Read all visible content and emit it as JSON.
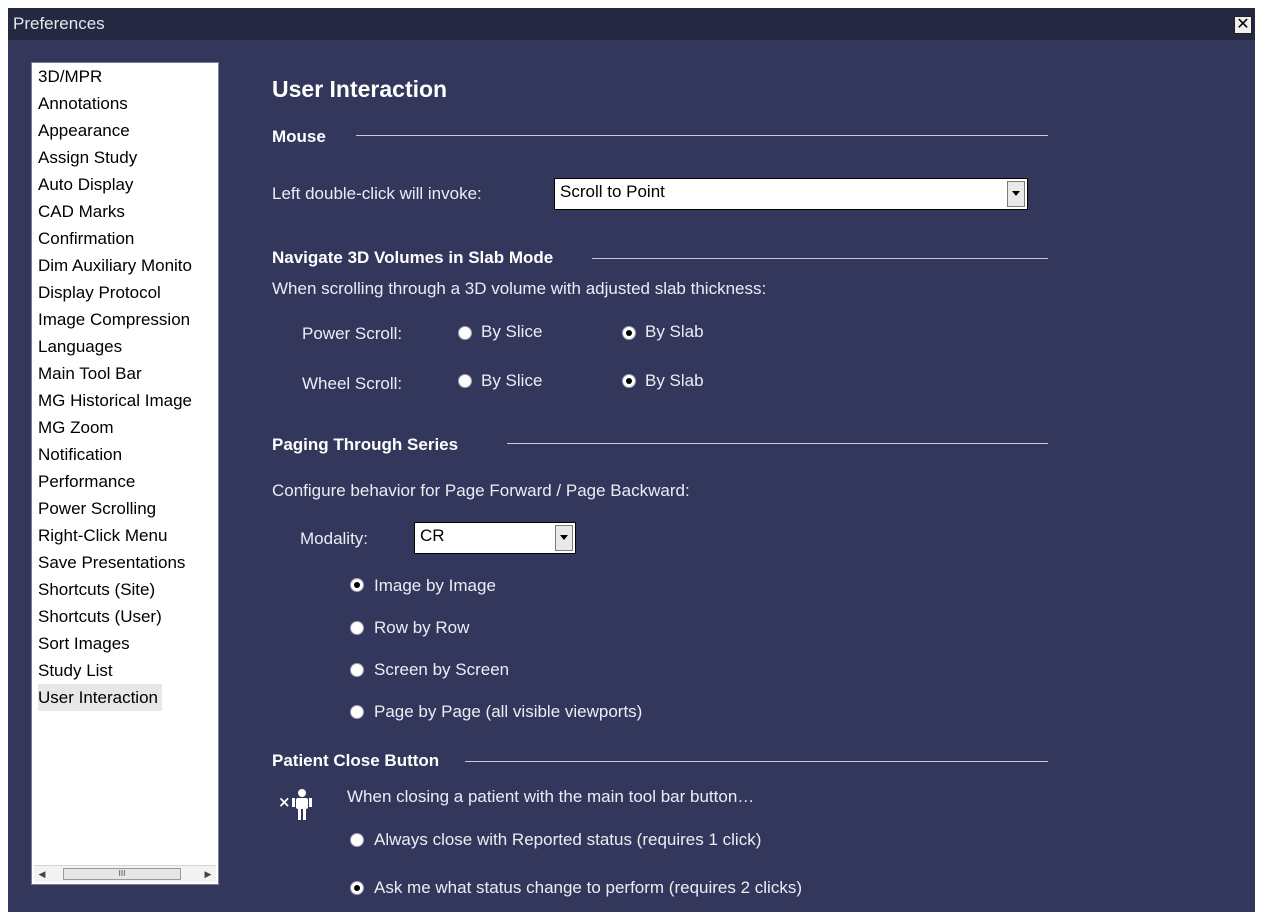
{
  "window": {
    "title": "Preferences",
    "close_label": "✕"
  },
  "sidebar": {
    "items": [
      "3D/MPR",
      "Annotations",
      "Appearance",
      "Assign Study",
      "Auto Display",
      "CAD Marks",
      "Confirmation",
      "Dim Auxiliary Monito",
      "Display Protocol",
      "Image Compression",
      "Languages",
      "Main Tool Bar",
      "MG Historical Image",
      "MG Zoom",
      "Notification",
      "Performance",
      "Power Scrolling",
      "Right-Click Menu",
      "Save Presentations",
      "Shortcuts (Site)",
      "Shortcuts (User)",
      "Sort Images",
      "Study List",
      "User Interaction"
    ],
    "selected": "User Interaction",
    "scroll_grip": "III"
  },
  "main": {
    "title": "User Interaction",
    "mouse": {
      "heading": "Mouse",
      "dblclick_label": "Left double-click will invoke:",
      "dblclick_value": "Scroll to Point"
    },
    "slab": {
      "heading": "Navigate 3D Volumes in Slab Mode",
      "description": "When scrolling through a 3D volume with adjusted slab thickness:",
      "power_label": "Power Scroll:",
      "wheel_label": "Wheel Scroll:",
      "by_slice": "By Slice",
      "by_slab": "By Slab",
      "power_selected": "By Slab",
      "wheel_selected": "By Slab"
    },
    "paging": {
      "heading": "Paging Through Series",
      "description": "Configure behavior for Page Forward / Page Backward:",
      "modality_label": "Modality:",
      "modality_value": "CR",
      "options": [
        "Image by Image",
        "Row by Row",
        "Screen by Screen",
        "Page by Page (all visible viewports)"
      ],
      "selected": "Image by Image"
    },
    "close": {
      "heading": "Patient Close Button",
      "description": "When closing a patient with the main tool bar button…",
      "option_1": "Always close with Reported status (requires 1 click)",
      "option_2": "Ask me what status change to perform (requires 2 clicks)",
      "selected": "option_2",
      "icon": "close-patient-icon"
    }
  }
}
